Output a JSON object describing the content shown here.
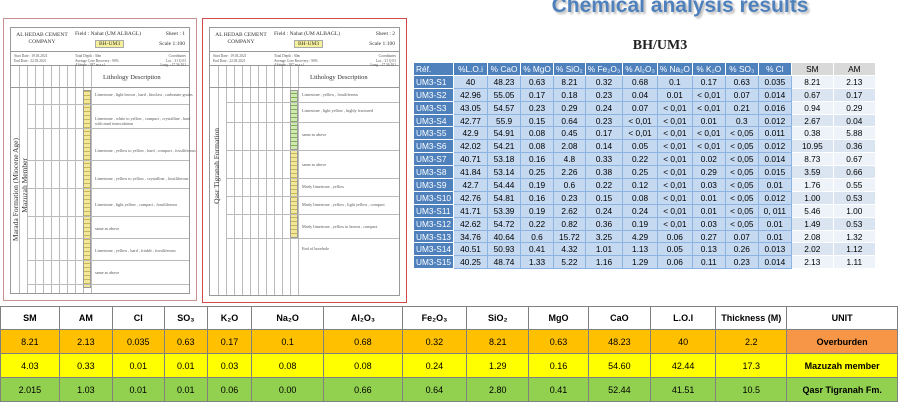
{
  "title": "Chemical analysis results",
  "subtitle": "BH/UM3",
  "sheets": [
    {
      "company": "AL HEDAB CEMENT COMPANY",
      "field": "Field : Nahat (UM ALBAGL)",
      "well": "BH-UM3",
      "sheet": "Sheet : 1",
      "scale": "Scale 1:100",
      "start_date": "Start Date : 19.03.2021",
      "end_date": "End Date : 22.03.2021",
      "depth": "Total Depth : 30m",
      "recovery": "Average Core Recovery : 90%",
      "altitude": "Altitude : 397 m.a.s.l",
      "coords_title": "Coordinates",
      "lat": "Lat. : 31 Q 03",
      "long": "Long. : 17 56 101",
      "lithology_title": "Lithology Description",
      "formation_label": "Marada Formation (Miocene Age)",
      "member_label": "Mazuzah Member",
      "descriptions": [
        "Limestone , light brown , hard , bioclast , carbonate grains",
        "Limestone , white to yellow , compact , crystalline , hard",
        "with marl intercalation",
        "Limestone , yellow to yellow , hard , compact , fossiliferous",
        "Limestone , yellow to yellow , crystalline , fossiliferous",
        "Limestone , light yellow , compact , fossiliferous",
        "same as above",
        "Limestone , yellow , hard , friable , fossiliferous",
        "same as above"
      ]
    },
    {
      "company": "AL HEDAB CEMENT COMPANY",
      "field": "Field : Nahat (UM ALBAGL)",
      "well": "BH-UM3",
      "sheet": "Sheet : 2",
      "scale": "Scale 1:100",
      "start_date": "Start Date : 19.03.2021",
      "end_date": "End Date : 22.03.2021",
      "depth": "Total Depth : 30m",
      "recovery": "Average Core Recovery : 90%",
      "altitude": "Altitude : 397 m.a.s.l",
      "coords_title": "Coordinates",
      "lat": "Lat. : 31 Q 03",
      "long": "Long. : 17 56 101",
      "lithology_title": "Lithology Description",
      "formation_label": "Qasr Tigranah Formation",
      "descriptions": [
        "Limestone , yellow , fossiliferous",
        "Limestone , light yellow , highly fractured",
        "same as above",
        "same as above",
        "Marly limestone , yellow",
        "Marly limestone , yellow , light yellow , compact",
        "Marly limestone , yellow to brown , compact",
        "End of borehole"
      ]
    }
  ],
  "results": {
    "headers": [
      "Réf.",
      "%L.O.i",
      "% CaO",
      "% MgO",
      "% SiO₂",
      "% Fe₂O₃",
      "% Al₂O₃",
      "% Na₂O",
      "% K₂O",
      "% SO₃",
      "% Cl",
      "SM",
      "AM"
    ],
    "rows": [
      [
        "UM3-S1",
        "40",
        "48.23",
        "0.63",
        "8.21",
        "0.32",
        "0.68",
        "0.1",
        "0.17",
        "0.63",
        "0.035",
        "8.21",
        "2.13"
      ],
      [
        "UM3-S2",
        "42.96",
        "55.05",
        "0.17",
        "0.18",
        "0.23",
        "0.04",
        "0.01",
        "< 0,01",
        "0.07",
        "0.014",
        "0.67",
        "0.17"
      ],
      [
        "UM3-S3",
        "43.05",
        "54.57",
        "0.23",
        "0.29",
        "0.24",
        "0.07",
        "< 0,01",
        "< 0,01",
        "0.21",
        "0.016",
        "0.94",
        "0.29"
      ],
      [
        "UM3-S4",
        "42.77",
        "55.9",
        "0.15",
        "0.64",
        "0.23",
        "< 0,01",
        "< 0,01",
        "0.01",
        "0.3",
        "0.012",
        "2.67",
        "0.04"
      ],
      [
        "UM3-S5",
        "42.9",
        "54.91",
        "0.08",
        "0.45",
        "0.17",
        "< 0,01",
        "< 0,01",
        "< 0,01",
        "< 0,05",
        "0.011",
        "0.38",
        "5.88"
      ],
      [
        "UM3-S6",
        "42.02",
        "54.21",
        "0.08",
        "2.08",
        "0.14",
        "0.05",
        "< 0,01",
        "< 0,01",
        "< 0,05",
        "0.012",
        "10.95",
        "0.36"
      ],
      [
        "UM3-S7",
        "40.71",
        "53.18",
        "0.16",
        "4.8",
        "0.33",
        "0.22",
        "< 0,01",
        "0.02",
        "< 0,05",
        "0.014",
        "8.73",
        "0.67"
      ],
      [
        "UM3-S8",
        "41.84",
        "53.14",
        "0.25",
        "2.26",
        "0.38",
        "0.25",
        "< 0,01",
        "0.29",
        "< 0,05",
        "0.015",
        "3.59",
        "0.66"
      ],
      [
        "UM3-S9",
        "42.7",
        "54.44",
        "0.19",
        "0.6",
        "0.22",
        "0.12",
        "< 0,01",
        "0.03",
        "< 0,05",
        "0.01",
        "1.76",
        "0.55"
      ],
      [
        "UM3-S10",
        "42.76",
        "54.81",
        "0.16",
        "0.23",
        "0.15",
        "0.08",
        "< 0,01",
        "0.01",
        "< 0,05",
        "0.012",
        "1.00",
        "0.53"
      ],
      [
        "UM3-S11",
        "41.71",
        "53.39",
        "0.19",
        "2.62",
        "0.24",
        "0.24",
        "< 0,01",
        "0.01",
        "< 0,05",
        "0, 011",
        "5.46",
        "1.00"
      ],
      [
        "UM3-S12",
        "42.62",
        "54.72",
        "0.22",
        "0.82",
        "0.36",
        "0.19",
        "< 0,01",
        "0.03",
        "< 0,05",
        "0.01",
        "1.49",
        "0.53"
      ],
      [
        "UM3-S13",
        "34.76",
        "40.64",
        "0.6",
        "15.72",
        "3.25",
        "4.29",
        "0.06",
        "0.27",
        "0.07",
        "0.01",
        "2.08",
        "1.32"
      ],
      [
        "UM3-S14",
        "40.51",
        "50.93",
        "0.41",
        "4.32",
        "1.01",
        "1.13",
        "0.05",
        "0.13",
        "0.26",
        "0.013",
        "2.02",
        "1.12"
      ],
      [
        "UM3-S15",
        "40.25",
        "48.74",
        "1.33",
        "5.22",
        "1.16",
        "1.29",
        "0.06",
        "0.11",
        "0.23",
        "0.014",
        "2.13",
        "1.11"
      ]
    ]
  },
  "summary": {
    "headers": [
      "SM",
      "AM",
      "Cl",
      "SO₃",
      "K₂O",
      "Na₂O",
      "Al₂O₃",
      "Fe₂O₃",
      "SiO₂",
      "MgO",
      "CaO",
      "L.O.I",
      "Thickness (M)",
      "UNIT"
    ],
    "rows": [
      [
        "8.21",
        "2.13",
        "0.035",
        "0.63",
        "0.17",
        "0.1",
        "0.68",
        "0.32",
        "8.21",
        "0.63",
        "48.23",
        "40",
        "2.2",
        "Overburden"
      ],
      [
        "4.03",
        "0.33",
        "0.01",
        "0.01",
        "0.03",
        "0.08",
        "0.08",
        "0.24",
        "1.29",
        "0.16",
        "54.60",
        "42.44",
        "17.3",
        "Mazuzah member"
      ],
      [
        "2.015",
        "1.03",
        "0.01",
        "0.01",
        "0.06",
        "0.00",
        "0.66",
        "0.64",
        "2.80",
        "0.41",
        "52.44",
        "41.51",
        "10.5",
        "Qasr Tigranah  Fm."
      ]
    ],
    "row_colors": [
      "#ffc000",
      "#ffff00",
      "#92d050"
    ]
  }
}
